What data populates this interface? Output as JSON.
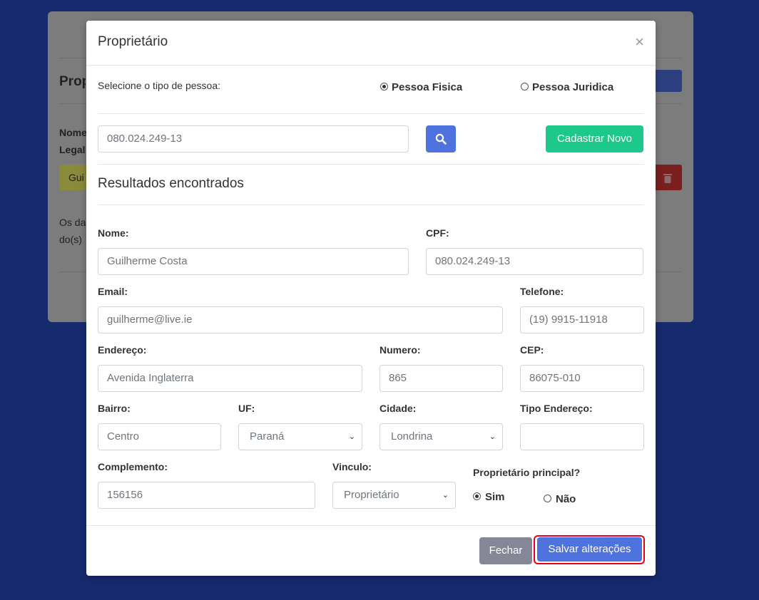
{
  "background": {
    "title": "Prop",
    "label_1": "Nome",
    "label_2": "Legal",
    "yellow_text": "Gui",
    "text_1": "Os da",
    "text_2": "do(s)"
  },
  "modal": {
    "title": "Proprietário",
    "close": "×",
    "person_type": {
      "label": "Selecione o tipo de pessoa:",
      "options": [
        "Pessoa Fisica",
        "Pessoa Juridica"
      ],
      "selected": "Pessoa Fisica"
    },
    "search": {
      "value": "080.024.249-13",
      "new_button": "Cadastrar Novo"
    },
    "results_title": "Resultados encontrados",
    "fields": {
      "nome": {
        "label": "Nome:",
        "value": "Guilherme Costa"
      },
      "cpf": {
        "label": "CPF:",
        "value": "080.024.249-13"
      },
      "email": {
        "label": "Email:",
        "value": "guilherme@live.ie"
      },
      "telefone": {
        "label": "Telefone:",
        "value": "(19) 9915-11918"
      },
      "endereco": {
        "label": "Endereço:",
        "value": "Avenida Inglaterra"
      },
      "numero": {
        "label": "Numero:",
        "value": "865"
      },
      "cep": {
        "label": "CEP:",
        "value": "86075-010"
      },
      "bairro": {
        "label": "Bairro:",
        "value": "Centro"
      },
      "uf": {
        "label": "UF:",
        "value": "Paraná"
      },
      "cidade": {
        "label": "Cidade:",
        "value": "Londrina"
      },
      "tipo_endereco": {
        "label": "Tipo Endereço:",
        "value": ""
      },
      "complemento": {
        "label": "Complemento:",
        "value": "156156"
      },
      "vinculo": {
        "label": "Vinculo:",
        "value": "Proprietário"
      }
    },
    "principal": {
      "label": "Proprietário principal?",
      "options": [
        "Sim",
        "Não"
      ],
      "selected": "Sim"
    },
    "buttons": {
      "close": "Fechar",
      "save": "Salvar alterações"
    }
  }
}
